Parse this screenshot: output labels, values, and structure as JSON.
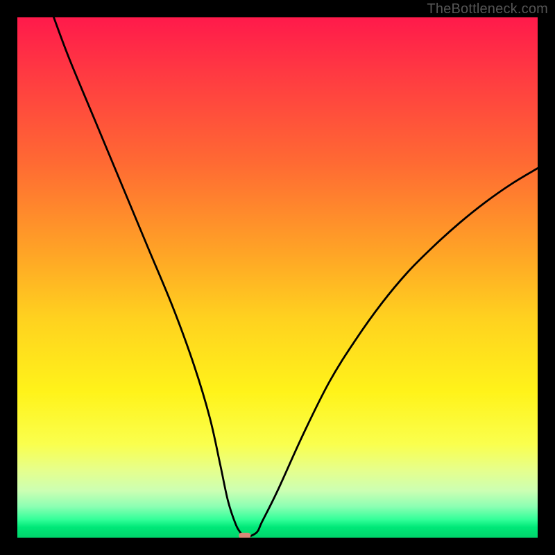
{
  "watermark": "TheBottleneck.com",
  "chart_data": {
    "type": "line",
    "title": "",
    "xlabel": "",
    "ylabel": "",
    "xlim": [
      0,
      100
    ],
    "ylim": [
      0,
      100
    ],
    "legend": false,
    "grid": false,
    "background_gradient": {
      "top": "#ff1a4b",
      "middle": "#ffd21f",
      "bottom": "#00d46b"
    },
    "series": [
      {
        "name": "bottleneck-curve",
        "color": "#000000",
        "x": [
          7,
          10,
          15,
          20,
          25,
          30,
          34,
          37,
          39,
          40.5,
          42,
          43,
          43.5,
          44,
          46,
          47,
          50,
          55,
          60,
          65,
          70,
          75,
          80,
          85,
          90,
          95,
          100
        ],
        "y": [
          100,
          92,
          80,
          68,
          56,
          44,
          33,
          23,
          14,
          7,
          2.5,
          0.8,
          0,
          0,
          1,
          3,
          9,
          20,
          30,
          38,
          45,
          51,
          56,
          60.5,
          64.5,
          68,
          71
        ]
      }
    ],
    "marker": {
      "name": "optimal-point",
      "x": 43.7,
      "y": 0.4,
      "color": "#d88878",
      "shape": "rounded-rect",
      "width_pct": 2.3,
      "height_pct": 1.1
    }
  }
}
